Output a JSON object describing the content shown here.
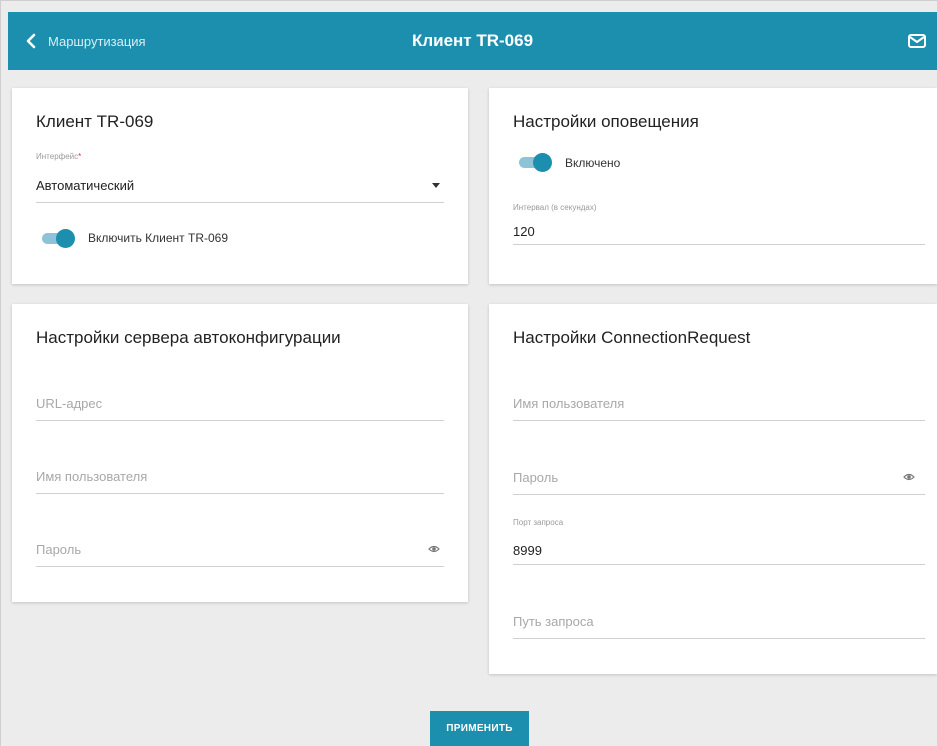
{
  "header": {
    "back_label": "Маршрутизация",
    "title": "Клиент TR-069",
    "mail_icon": "mail-icon"
  },
  "client_card": {
    "title": "Клиент TR-069",
    "interface_label": "Интерфейс",
    "interface_required_mark": "*",
    "interface_value": "Автоматический",
    "toggle_label": "Включить Клиент TR-069",
    "toggle_on": true
  },
  "notify_card": {
    "title": "Настройки оповещения",
    "toggle_label": "Включено",
    "toggle_on": true,
    "interval_label": "Интервал (в секундах)",
    "interval_value": "120"
  },
  "acs_card": {
    "title": "Настройки сервера автоконфигурации",
    "url_placeholder": "URL-адрес",
    "username_placeholder": "Имя пользователя",
    "password_placeholder": "Пароль"
  },
  "connreq_card": {
    "title": "Настройки ConnectionRequest",
    "username_placeholder": "Имя пользователя",
    "password_placeholder": "Пароль",
    "port_label": "Порт запроса",
    "port_value": "8999",
    "path_placeholder": "Путь запроса"
  },
  "actions": {
    "apply_label": "ПРИМЕНИТЬ"
  },
  "colors": {
    "accent": "#1c8fae",
    "toggle_track": "#8cc3d6",
    "background": "#ececec"
  }
}
